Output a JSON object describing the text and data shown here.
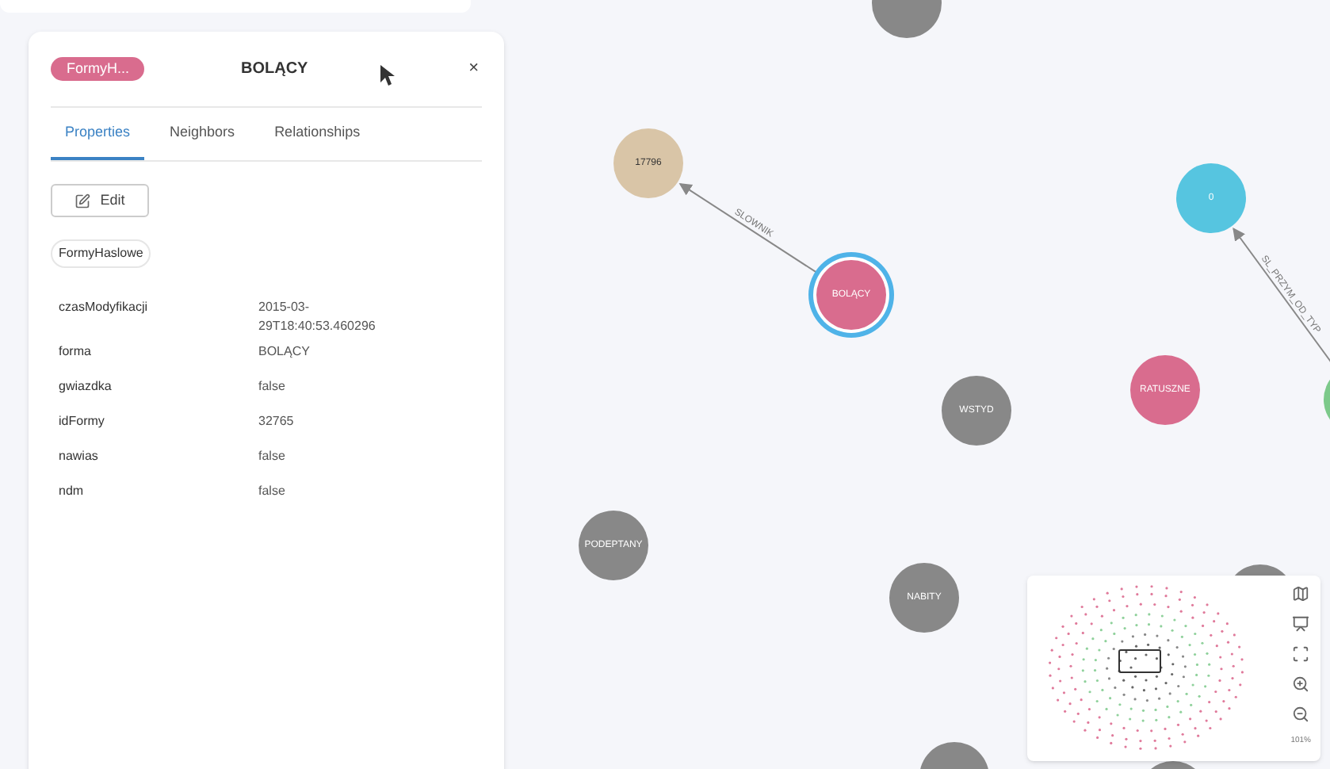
{
  "panel": {
    "badge": {
      "text": "FormyH...",
      "color": "#d96c8e"
    },
    "title": "BOLĄCY",
    "close": "×",
    "tabs": [
      {
        "label": "Properties",
        "selected": true
      },
      {
        "label": "Neighbors",
        "selected": false
      },
      {
        "label": "Relationships",
        "selected": false
      }
    ],
    "edit_button": "Edit",
    "label_chip": "FormyHaslowe",
    "properties": [
      {
        "key": "czasModyfikacji",
        "value": "2015-03-\n29T18:40:53.460296"
      },
      {
        "key": "forma",
        "value": "BOLĄCY"
      },
      {
        "key": "gwiazdka",
        "value": "false"
      },
      {
        "key": "idFormy",
        "value": "32765"
      },
      {
        "key": "nawias",
        "value": "false"
      },
      {
        "key": "ndm",
        "value": "false"
      }
    ]
  },
  "graph": {
    "nodes": [
      {
        "color": "#888888",
        "selected": false
      },
      {
        "label": "17796",
        "color": "#d9c5a7",
        "selected": false
      },
      {
        "label": "BOLĄCY",
        "color": "#d96c8e",
        "selected": true
      },
      {
        "label": "0",
        "color": "#56c5e0",
        "selected": false
      },
      {
        "label": "RATUSZNE",
        "color": "#d96c8e",
        "selected": false
      },
      {
        "label": "WSTYD",
        "color": "#888888",
        "selected": false
      },
      {
        "color": "#7cc98a",
        "selected": false
      },
      {
        "label": "PODEPTANY",
        "color": "#888888",
        "selected": false
      },
      {
        "label": "NABITY",
        "color": "#888888",
        "selected": false
      },
      {
        "color": "#888888",
        "selected": false
      },
      {
        "color": "#888888",
        "selected": false
      },
      {
        "color": "#888888",
        "selected": false
      }
    ],
    "edges": [
      {
        "label": "SLOWNIK"
      },
      {
        "label": "SL_PRZYM_OD_TYP"
      }
    ]
  },
  "minimap": {
    "zoom": "101%"
  }
}
